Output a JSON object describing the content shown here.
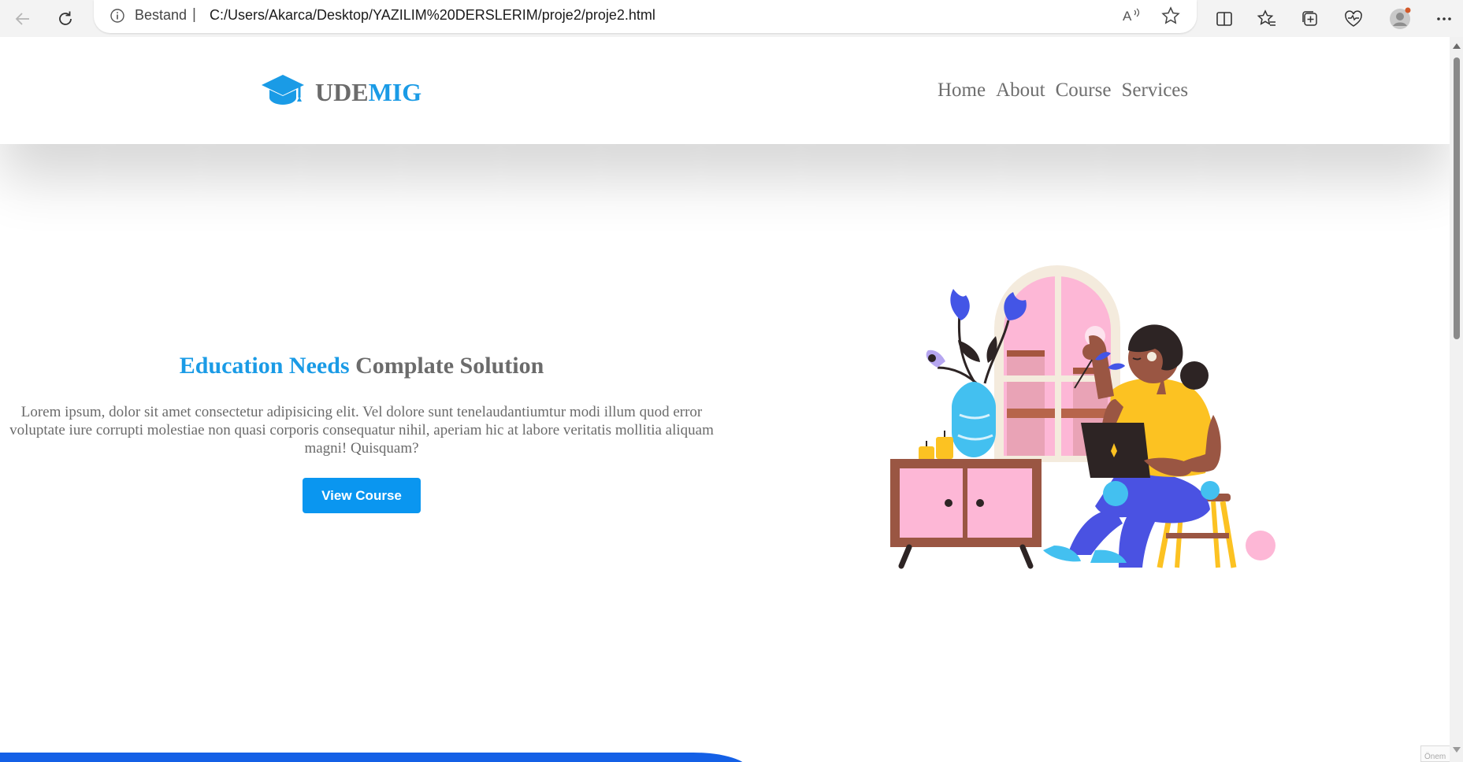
{
  "browser": {
    "site_label": "Bestand",
    "separator": "|",
    "url": "C:/Users/Akarca/Desktop/YAZILIM%20DERSLERIM/proje2/proje2.html"
  },
  "header": {
    "logo_part1": "UDE",
    "logo_part2": "MIG",
    "nav": [
      "Home",
      "About",
      "Course",
      "Services"
    ]
  },
  "hero": {
    "title_highlight": "Education Needs",
    "title_rest": "Complate Solution",
    "paragraph": "Lorem ipsum, dolor sit amet consectetur adipisicing elit. Vel dolore sunt tenelaudantiumtur modi illum quod error voluptate iure corrupti molestiae non quasi corporis consequatur nihil, aperiam hic at labore veritatis mollitia aliquam magni! Quisquam?",
    "button_label": "View Course"
  },
  "corner_label": "Önem",
  "colors": {
    "brand_blue": "#1a9be6",
    "button_blue": "#0a96f0",
    "text_gray": "#6b6b6b",
    "footer_blue": "#1460e6"
  },
  "icons": [
    "back-arrow-icon",
    "reload-icon",
    "info-icon",
    "read-aloud-icon",
    "favorite-star-icon",
    "split-screen-icon",
    "favorites-icon",
    "collections-icon",
    "health-icon",
    "profile-avatar-icon",
    "more-icon",
    "graduation-cap-icon"
  ]
}
